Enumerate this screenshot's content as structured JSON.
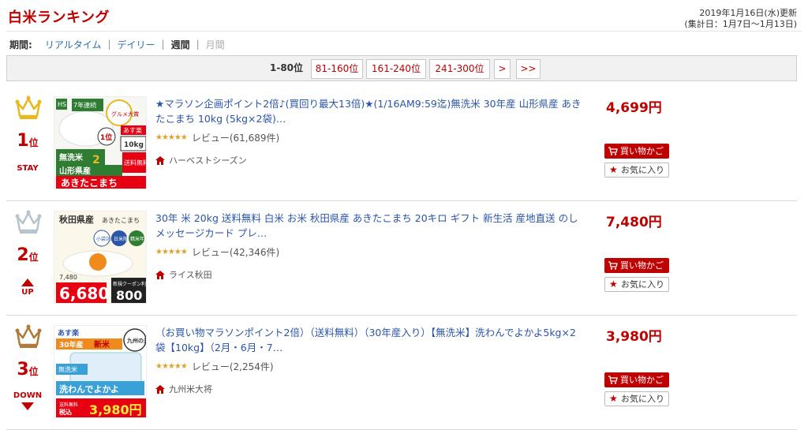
{
  "header": {
    "title": "白米ランキング",
    "updated": "2019年1月16日(水)更新",
    "period_range": "(集計日：1月7日～1月13日)"
  },
  "period": {
    "label": "期間:",
    "options": [
      "リアルタイム",
      "デイリー",
      "週間",
      "月間"
    ],
    "current": "週間",
    "separator": "|"
  },
  "pager": {
    "current": "1-80位",
    "links": [
      "81-160位",
      "161-240位",
      "241-300位",
      ">",
      ">>"
    ]
  },
  "colors": {
    "accent": "#bf0000",
    "link": "#2a55a8",
    "crown_gold": "#e8b820",
    "crown_silver": "#b8c4cc",
    "crown_bronze": "#b07a3c",
    "star": "#e0a12b"
  },
  "items": [
    {
      "rank": "1",
      "rank_unit": "位",
      "trend": "STAY",
      "trend_icon": "none",
      "crown": "gold-crown-icon",
      "title": "★マラソン企画ポイント2倍♪(買回り最大13倍)★(1/16AM9:59迄)無洗米 30年産 山形県産 あきたこまち 10kg (5kg×2袋)…",
      "stars": "★★★★★",
      "rating_value": 4.5,
      "reviews": "レビュー(61,689件)",
      "shop": "ハーベストシーズン",
      "price": "4,699円",
      "cart_label": "買い物かご",
      "fav_label": "お気に入り",
      "thumb": {
        "badges": [
          "HS",
          "7年連続",
          "グルメ大賞"
        ],
        "lines": [
          "あす楽",
          "無洗米",
          "2",
          "送料無料",
          "山形県産",
          "あきたこまち"
        ],
        "weight": "10kg",
        "rank_badge": "1位"
      }
    },
    {
      "rank": "2",
      "rank_unit": "位",
      "trend": "UP",
      "trend_icon": "up-arrow-icon",
      "crown": "silver-crown-icon",
      "title": "30年 米 20kg 送料無料 白米 お米 秋田県産 あきたこまち 20キロ ギフト 新生活 産地直送 のし メッセージカード プレ…",
      "stars": "★★★★★",
      "rating_value": 4.5,
      "reviews": "レビュー(42,346件)",
      "shop": "ライス秋田",
      "price": "7,480円",
      "cart_label": "買い物かご",
      "fav_label": "お気に入り",
      "thumb": {
        "lines": [
          "秋田県産",
          "あきたこまち",
          "小袋対応",
          "日米限定",
          "精米年数18"
        ],
        "old_price": "7,480",
        "sale_price": "6,680",
        "coupon": "新規クーポン利用で",
        "coupon_price": "800"
      }
    },
    {
      "rank": "3",
      "rank_unit": "位",
      "trend": "DOWN",
      "trend_icon": "down-arrow-icon",
      "crown": "bronze-crown-icon",
      "title": "（お買い物マラソンポイント2倍）（送料無料）（30年産入り）【無洗米】洗わんでよかよ5kg×2袋【10kg】（2月・6月・7…",
      "stars": "★★★★★",
      "rating_value": 4.5,
      "reviews": "レビュー(2,254件)",
      "shop": "九州米大将",
      "price": "3,980円",
      "cart_label": "買い物かご",
      "fav_label": "お気に入り",
      "thumb": {
        "lines": [
          "あす楽",
          "30年産",
          "新米",
          "九州の米",
          "無洗米",
          "洗わんでよかよ",
          "送料無料",
          "税込"
        ],
        "price": "3,980円"
      }
    }
  ]
}
